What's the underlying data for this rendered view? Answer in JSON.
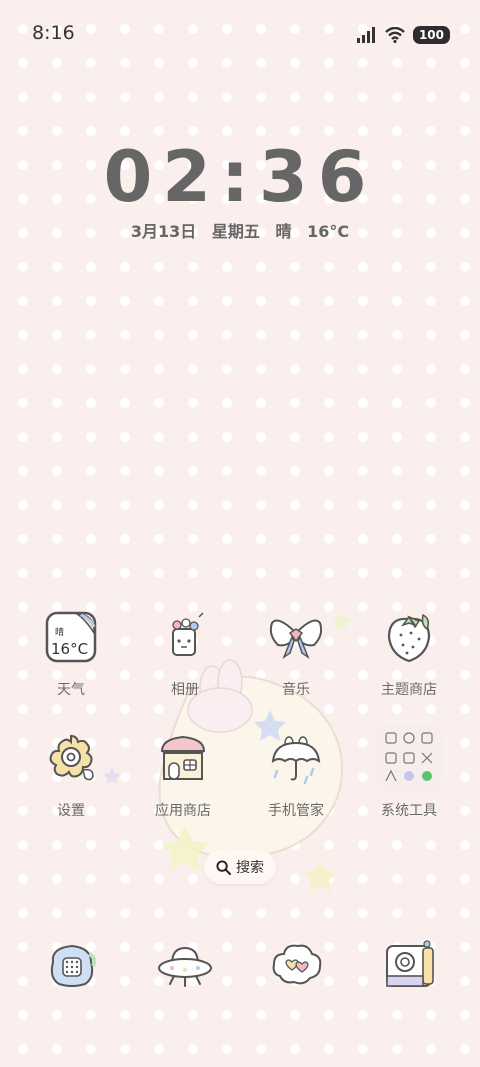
{
  "status_bar": {
    "time": "8:16",
    "battery": "100"
  },
  "clock": {
    "time": "02:36"
  },
  "date_row": {
    "date": "3月13日",
    "weekday": "星期五",
    "weather": "晴",
    "temperature": "16°C"
  },
  "weather_icon": {
    "condition": "晴",
    "temperature": "16°C"
  },
  "apps": [
    {
      "label": "天气",
      "icon": "weather-icon"
    },
    {
      "label": "相册",
      "icon": "gallery-icon"
    },
    {
      "label": "音乐",
      "icon": "music-bow-icon"
    },
    {
      "label": "主题商店",
      "icon": "strawberry-icon"
    },
    {
      "label": "设置",
      "icon": "gear-flower-icon"
    },
    {
      "label": "应用商店",
      "icon": "house-icon"
    },
    {
      "label": "手机管家",
      "icon": "umbrella-icon"
    },
    {
      "label": "系统工具",
      "icon": "folder-icon"
    }
  ],
  "search": {
    "label": "搜索"
  },
  "dock": [
    {
      "icon": "phone-icon"
    },
    {
      "icon": "ufo-browser-icon"
    },
    {
      "icon": "message-cloud-icon"
    },
    {
      "icon": "camera-icon"
    }
  ],
  "colors": {
    "background": "#fbefed",
    "text": "#666666",
    "accent_pink": "#f4b6c2",
    "accent_blue": "#aecbf0"
  }
}
